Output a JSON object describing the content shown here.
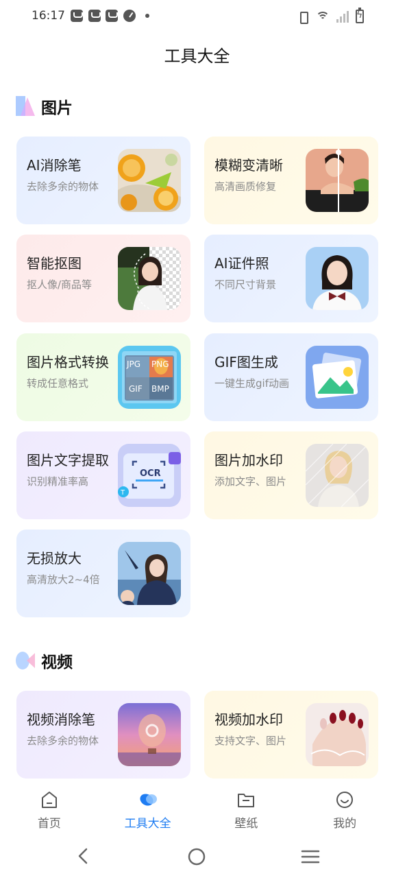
{
  "status_bar": {
    "time": "16:17"
  },
  "page": {
    "title": "工具大全"
  },
  "sections": {
    "images": {
      "title": "图片",
      "cards": [
        {
          "title": "AI消除笔",
          "subtitle": "去除多余的物体",
          "thumb": "fruit-photo"
        },
        {
          "title": "模糊变清晰",
          "subtitle": "高清画质修复",
          "thumb": "portrait-before-after"
        },
        {
          "title": "智能抠图",
          "subtitle": "抠人像/商品等",
          "thumb": "cutout-portrait"
        },
        {
          "title": "AI证件照",
          "subtitle": "不同尺寸背景",
          "thumb": "id-photo"
        },
        {
          "title": "图片格式转换",
          "subtitle": "转成任意格式",
          "thumb": "format-convert",
          "formats": [
            "JPG",
            "PNG",
            "GIF",
            "BMP"
          ]
        },
        {
          "title": "GIF图生成",
          "subtitle": "一键生成gif动画",
          "thumb": "gif-maker"
        },
        {
          "title": "图片文字提取",
          "subtitle": "识别精准率高",
          "thumb": "ocr",
          "ocr_label": "OCR"
        },
        {
          "title": "图片加水印",
          "subtitle": "添加文字、图片",
          "thumb": "watermark-portrait"
        },
        {
          "title": "无损放大",
          "subtitle": "高清放大2~4倍",
          "thumb": "upscale-portrait"
        }
      ]
    },
    "video": {
      "title": "视频",
      "cards": [
        {
          "title": "视频消除笔",
          "subtitle": "去除多余的物体",
          "thumb": "balloon-sunset"
        },
        {
          "title": "视频加水印",
          "subtitle": "支持文字、图片",
          "thumb": "nails-watermark"
        }
      ]
    }
  },
  "bottom_nav": [
    {
      "label": "首页",
      "icon": "home-icon",
      "active": false
    },
    {
      "label": "工具大全",
      "icon": "tools-icon",
      "active": true
    },
    {
      "label": "壁纸",
      "icon": "folder-icon",
      "active": false
    },
    {
      "label": "我的",
      "icon": "smile-icon",
      "active": false
    }
  ],
  "colors": {
    "accent": "#1e7cf2",
    "card_blue": "#e9f0ff",
    "card_yellow": "#fff9e6",
    "card_pink": "#fdecec",
    "card_green": "#f0fbe6",
    "card_purple": "#f1ecfe"
  }
}
